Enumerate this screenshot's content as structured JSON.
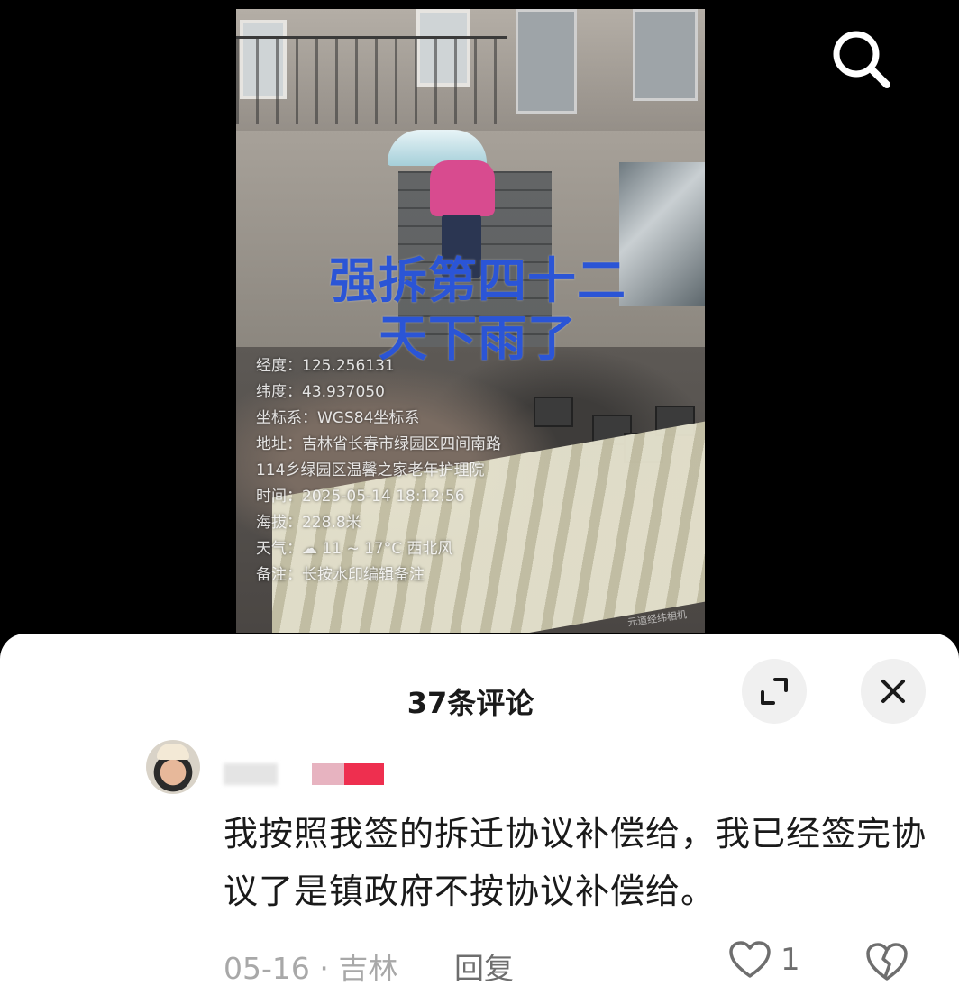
{
  "video": {
    "overlay_title_line1": "强拆第四十二",
    "overlay_title_line2": "天下雨了",
    "watermark": {
      "longitude": "经度：125.256131",
      "latitude": "纬度：43.937050",
      "coord_system": "坐标系：WGS84坐标系",
      "address": "地址：吉林省长春市绿园区四间南路114乡绿园区温馨之家老年护理院",
      "time": "时间：2025-05-14 18:12:56",
      "altitude": "海拔：228.8米",
      "weather": "天气：☁ 11 ~ 17°C 西北风",
      "note": "备注：长按水印编辑备注"
    },
    "brand_tag": "元道经纬相机"
  },
  "top_bar": {
    "search_icon": "search-icon"
  },
  "comments_panel": {
    "title": "37条评论",
    "expand_icon": "expand-icon",
    "close_icon": "close-icon",
    "comment": {
      "text": "我按照我签的拆迁协议补偿给，我已经签完协议了是镇政府不按协议补偿给。",
      "date_location": "05-16 · 吉林",
      "reply_label": "回复",
      "like_count": "1",
      "like_icon": "heart-icon",
      "dislike_icon": "broken-heart-icon"
    }
  },
  "colors": {
    "overlay_title": "#2b55d6",
    "username_badge": "#ee2f4f"
  }
}
